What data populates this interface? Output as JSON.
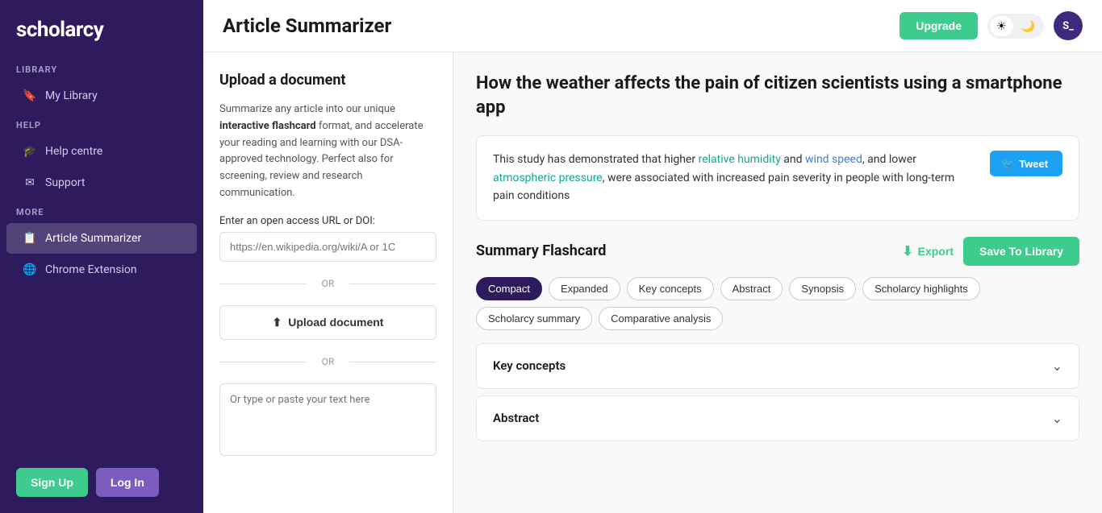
{
  "sidebar": {
    "logo": "scholarcy",
    "sections": [
      {
        "label": "Library",
        "items": [
          {
            "id": "my-library",
            "icon": "🔖",
            "text": "My Library",
            "active": false
          }
        ]
      },
      {
        "label": "Help",
        "items": [
          {
            "id": "help-centre",
            "icon": "🎓",
            "text": "Help centre",
            "active": false
          },
          {
            "id": "support",
            "icon": "✉",
            "text": "Support",
            "active": false
          }
        ]
      },
      {
        "label": "More",
        "items": [
          {
            "id": "article-summarizer",
            "icon": "📋",
            "text": "Article Summarizer",
            "active": true
          },
          {
            "id": "chrome-extension",
            "icon": "🌐",
            "text": "Chrome Extension",
            "active": false
          }
        ]
      }
    ],
    "buttons": {
      "signup": "Sign Up",
      "login": "Log In"
    }
  },
  "header": {
    "title": "Article Summarizer",
    "upgrade_label": "Upgrade",
    "theme_light": "☀",
    "theme_dark": "🌙",
    "user_initials": "S_"
  },
  "left_panel": {
    "upload_title": "Upload a document",
    "upload_desc_plain": "Summarize any article into our unique ",
    "upload_desc_bold": "interactive flashcard",
    "upload_desc_rest": " format, and accelerate your reading and learning with our DSA-approved technology. Perfect also for screening, review and research communication.",
    "url_label": "Enter an open access URL or DOI:",
    "url_placeholder": "https://en.wikipedia.org/wiki/A or 1C",
    "or_text": "OR",
    "upload_button": "Upload document",
    "or_text2": "OR",
    "text_placeholder": "Or type or paste your text here"
  },
  "right_panel": {
    "article_title": "How the weather affects the pain of citizen scientists using a smartphone app",
    "abstract_text_1": "This study has demonstrated that higher ",
    "abstract_link1": "relative humidity",
    "abstract_text_2": " and ",
    "abstract_link2": "wind speed",
    "abstract_text_3": ", and lower ",
    "abstract_link3": "atmospheric pressure",
    "abstract_text_4": ", were associated with increased pain severity in people with long-term pain conditions",
    "tweet_label": "Tweet",
    "flashcard_title": "Summary Flashcard",
    "export_label": "Export",
    "save_label": "Save To Library",
    "tags": [
      {
        "id": "compact",
        "label": "Compact",
        "active": true
      },
      {
        "id": "expanded",
        "label": "Expanded",
        "active": false
      },
      {
        "id": "key-concepts",
        "label": "Key concepts",
        "active": false
      },
      {
        "id": "abstract",
        "label": "Abstract",
        "active": false
      },
      {
        "id": "synopsis",
        "label": "Synopsis",
        "active": false
      },
      {
        "id": "scholarcy-highlights",
        "label": "Scholarcy highlights",
        "active": false
      },
      {
        "id": "scholarcy-summary",
        "label": "Scholarcy summary",
        "active": false
      },
      {
        "id": "comparative-analysis",
        "label": "Comparative analysis",
        "active": false
      }
    ],
    "sections": [
      {
        "id": "key-concepts",
        "title": "Key concepts"
      },
      {
        "id": "abstract",
        "title": "Abstract"
      }
    ]
  }
}
